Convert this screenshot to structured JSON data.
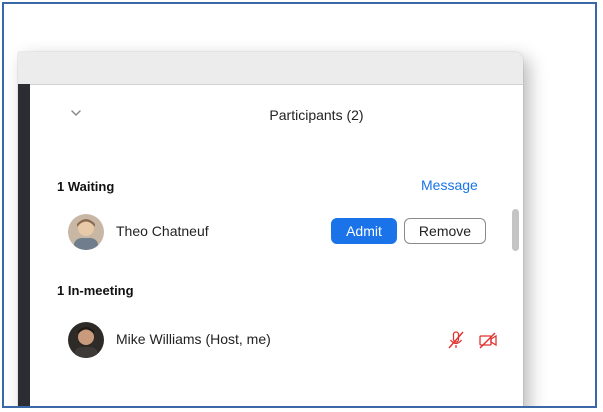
{
  "panel": {
    "title": "Participants (2)"
  },
  "waiting": {
    "heading": "1 Waiting",
    "message_label": "Message",
    "participants": [
      {
        "name": "Theo Chatneuf",
        "admit_label": "Admit",
        "remove_label": "Remove"
      }
    ]
  },
  "in_meeting": {
    "heading": "1 In-meeting",
    "participants": [
      {
        "name": "Mike Williams (Host, me)",
        "icons": [
          "muted-microphone-icon",
          "video-off-icon"
        ]
      }
    ]
  },
  "colors": {
    "accent": "#1a73e8",
    "muted_red": "#e0322f",
    "frame_border": "#3a67a8"
  }
}
